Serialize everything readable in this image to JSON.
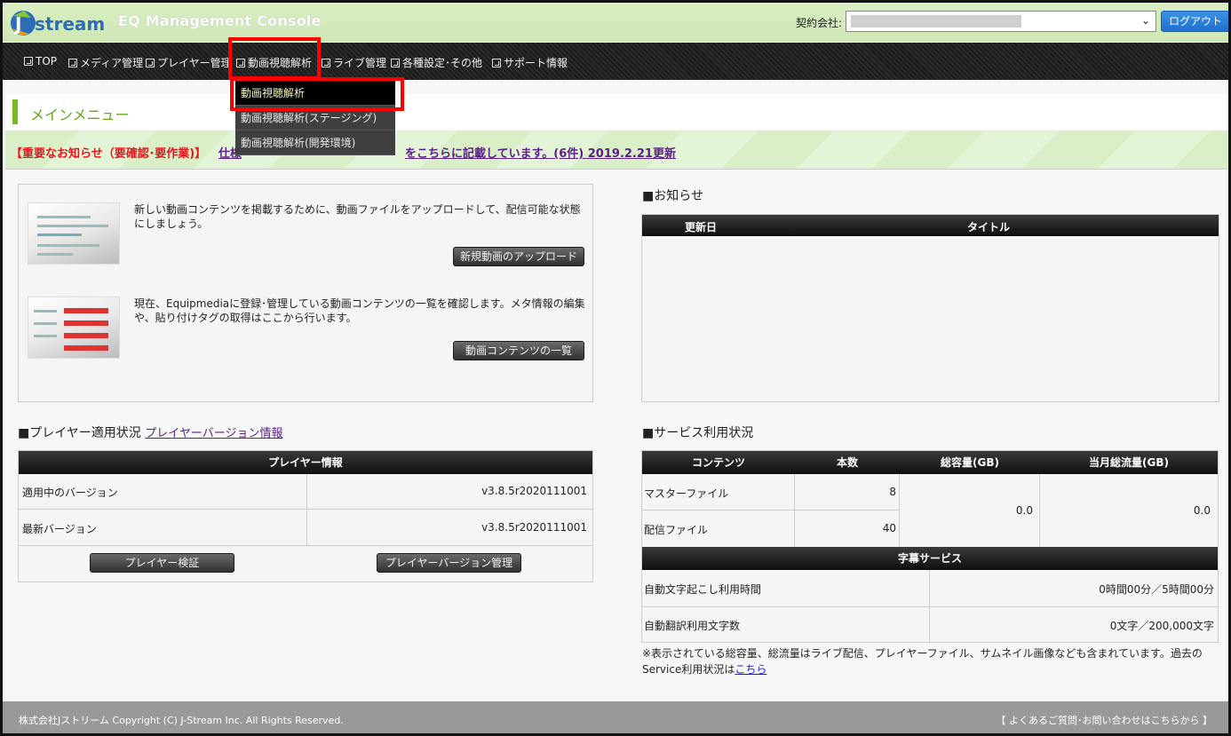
{
  "header": {
    "logo_text": "Jstream",
    "console_title": "EQ Management Console",
    "contract_label": "契約会社:",
    "logout_label": "ログアウト"
  },
  "nav": {
    "items": [
      {
        "label": "TOP"
      },
      {
        "label": "メディア管理"
      },
      {
        "label": "プレイヤー管理"
      },
      {
        "label": "動画視聴解析"
      },
      {
        "label": "ライブ管理"
      },
      {
        "label": "各種設定･その他"
      },
      {
        "label": "サポート情報"
      }
    ],
    "dropdown": [
      {
        "label": "動画視聴解析"
      },
      {
        "label": "動画視聴解析(ステージング)"
      },
      {
        "label": "動画視聴解析(開発環境)"
      }
    ]
  },
  "main_menu_title": "メインメニュー",
  "notice": {
    "important_label": "【重要なお知らせ（要確認･要作業)】",
    "link_prefix": "仕様",
    "link_text": "をこちらに記載しています。(6件) 2019.2.21更新"
  },
  "upload": {
    "upload_desc": "新しい動画コンテンツを掲載するために、動画ファイルをアップロードして、配信可能な状態にしましょう。",
    "upload_button": "新規動画のアップロード",
    "list_desc": "現在、Equipmediaに登録･管理している動画コンテンツの一覧を確認します。メタ情報の編集や、貼り付けタグの取得はここから行います。",
    "list_button": "動画コンテンツの一覧"
  },
  "news": {
    "title": "■お知らせ",
    "col_date": "更新日",
    "col_title": "タイトル"
  },
  "player": {
    "title": "■プレイヤー適用状況",
    "version_link": "プレイヤーバージョン情報",
    "table_header": "プレイヤー情報",
    "rows": [
      {
        "key": "適用中のバージョン",
        "value": "v3.8.5r2020111001"
      },
      {
        "key": "最新バージョン",
        "value": "v3.8.5r2020111001"
      }
    ],
    "verify_button": "プレイヤー検証",
    "manage_button": "プレイヤーバージョン管理"
  },
  "service": {
    "title": "■サービス利用状況",
    "headers": [
      "コンテンツ",
      "本数",
      "総容量(GB)",
      "当月総流量(GB)"
    ],
    "rows": [
      {
        "name": "マスターファイル",
        "count": "8"
      },
      {
        "name": "配信ファイル",
        "count": "40"
      }
    ],
    "total_capacity": "0.0",
    "monthly_traffic": "0.0",
    "subtitle_header": "字幕サービス",
    "subtitle_rows": [
      {
        "key": "自動文字起こし利用時間",
        "value": "0時間00分／5時間00分"
      },
      {
        "key": "自動翻訳利用文字数",
        "value": "0文字／200,000文字"
      }
    ],
    "note": "※表示されている総容量、総流量はライブ配信、プレイヤーファイル、サムネイル画像なども含まれています。過去のService利用状況は",
    "note_link": "こちら"
  },
  "footer": {
    "copyright": "株式会社Jストリーム  Copyright (C) J-Stream Inc. All Rights Reserved.",
    "faq": "【 よくあるご質問･お問い合わせはこちらから 】"
  },
  "colors": {
    "header_bg": "#d4ebbd",
    "accent_green": "#77bb22",
    "important_red": "#e4171d",
    "link_purple": "#5b1f86",
    "logout_blue": "#2a80da",
    "highlight_red": "#ff0000"
  }
}
